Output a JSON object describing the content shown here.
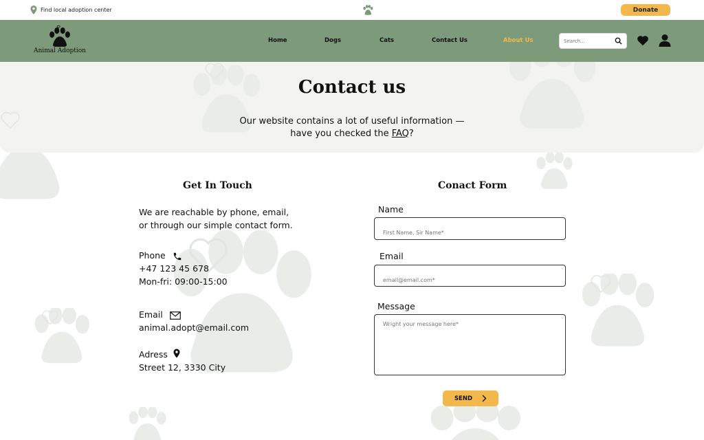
{
  "topbar": {
    "location_text": "Find local adoption center",
    "donate_label": "Donate"
  },
  "nav": {
    "logo_text": "Animal Adoption",
    "items": [
      {
        "label": "Home"
      },
      {
        "label": "Dogs"
      },
      {
        "label": "Cats"
      },
      {
        "label": "Contact Us"
      },
      {
        "label": "About Us"
      }
    ],
    "active_item": "About Us",
    "search_placeholder": "Search..."
  },
  "hero": {
    "title": "Contact us",
    "subtitle_line1": "Our website contains a lot of useful information —",
    "subtitle_line2_prefix": "have you checked the ",
    "faq_link": "FAQ",
    "subtitle_line2_suffix": "?"
  },
  "touch": {
    "title": "Get In Touch",
    "intro_line1": "We are reachable by phone, email,",
    "intro_line2": "or through our simple contact form.",
    "phone_label": "Phone",
    "phone_number": "+47 123 45 678",
    "phone_hours": "Mon-fri: 09:00-15:00",
    "email_label": "Email",
    "email_value": "animal.adopt@email.com",
    "address_label": "Adress",
    "address_value": "Street 12, 3330 City"
  },
  "form": {
    "title": "Conact Form",
    "name_label": "Name",
    "name_placeholder": "First Name, Sir Name*",
    "email_label": "Email",
    "email_placeholder": "email@email.com*",
    "message_label": "Message",
    "message_placeholder": "Wright your message here*",
    "send_label": "SEND"
  },
  "colors": {
    "nav_bg": "#7d9a7a",
    "accent": "#f2b84b",
    "hero_bg": "#f3f4f1",
    "paw_bg": "#e9ece7"
  },
  "icons": [
    "location-pin-icon",
    "paw-icon",
    "search-icon",
    "heart-icon",
    "user-icon",
    "phone-icon",
    "envelope-icon",
    "chevron-right-icon"
  ]
}
